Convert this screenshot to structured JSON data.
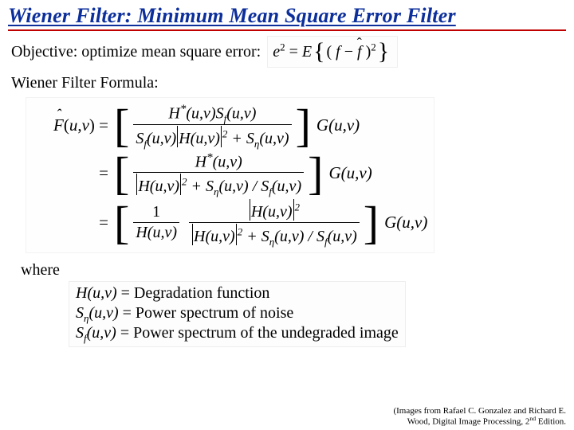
{
  "title": "Wiener Filter: Minimum Mean Square Error Filter",
  "objective_label": "Objective: optimize mean square error:",
  "formula_label": "Wiener Filter Formula:",
  "where_label": "where",
  "defs": {
    "h": {
      "sym": "H(u,v)",
      "eq": " = Degradation function"
    },
    "sn": {
      "pre": "S",
      "sub": "η",
      "args": "(u,v)",
      "eq": " = Power spectrum of noise"
    },
    "sf": {
      "pre": "S",
      "sub": "f",
      "args": "(u,v)",
      "eq": " = Power spectrum of the undegraded image"
    }
  },
  "attrib": {
    "l1": "(Images from Rafael C. Gonzalez and Richard E.",
    "l2_pre": "Wood, Digital Image Processing, 2",
    "l2_sup": "nd",
    "l2_post": " Edition."
  }
}
